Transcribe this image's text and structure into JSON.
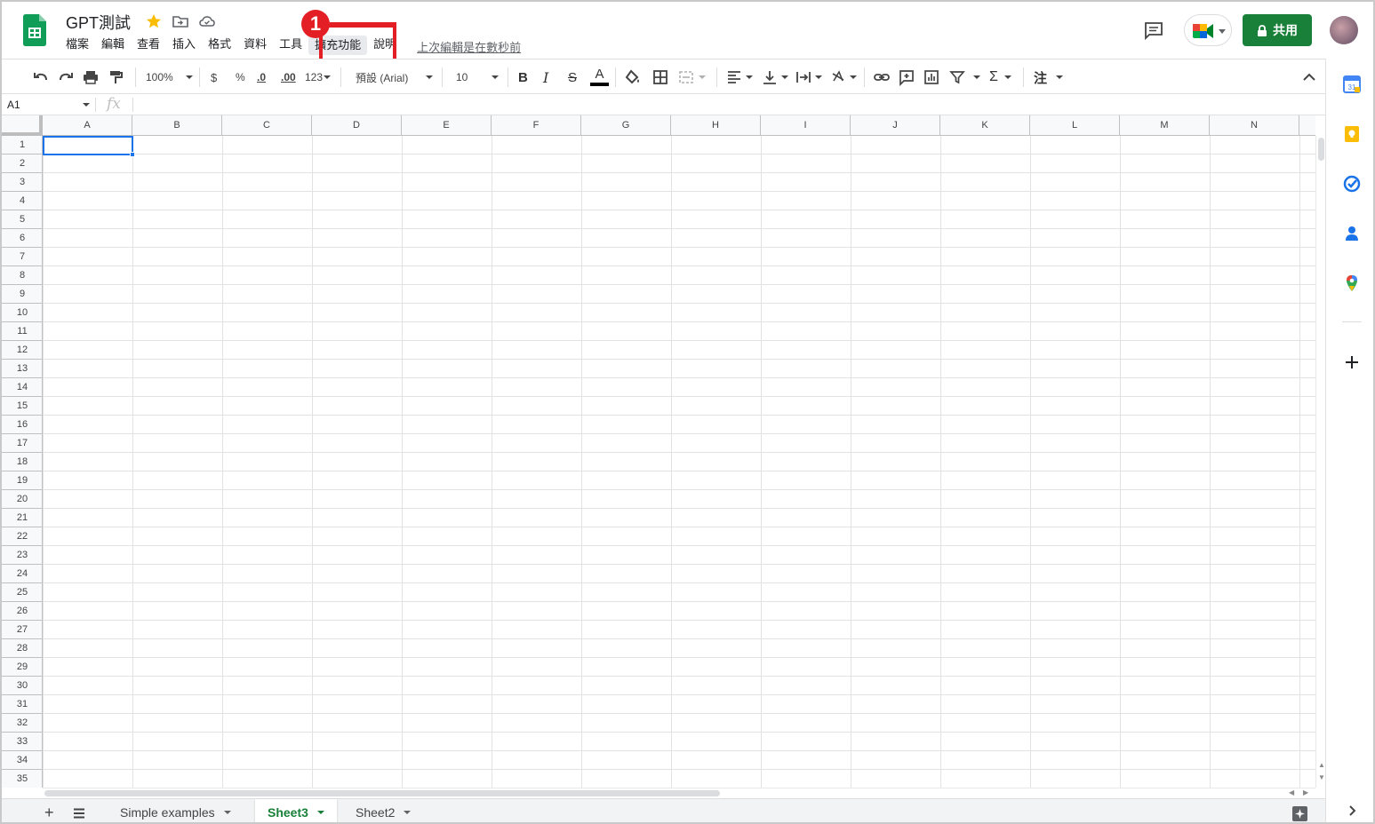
{
  "app": {
    "doc_title": "GPT測試",
    "last_edit": "上次編輯是在數秒前"
  },
  "menu": {
    "items": [
      "檔案",
      "編輯",
      "查看",
      "插入",
      "格式",
      "資料",
      "工具",
      "擴充功能",
      "說明"
    ],
    "active_index": 7
  },
  "annotation": {
    "step": "1",
    "color": "#e31e24"
  },
  "header": {
    "share_label": "共用",
    "share_color": "#188038"
  },
  "toolbar": {
    "zoom": "100%",
    "currency": "$",
    "percent": "%",
    "decrease_decimal": ".0",
    "increase_decimal": ".00",
    "more_formats": "123",
    "font": "預設 (Arial)",
    "font_size": "10",
    "bold": "B",
    "italic": "I",
    "strike": "S",
    "text_color": "A",
    "sigma": "Σ",
    "input_tools": "注"
  },
  "formula_bar": {
    "name_box": "A1",
    "fx": "fx"
  },
  "grid": {
    "columns": [
      "A",
      "B",
      "C",
      "D",
      "E",
      "F",
      "G",
      "H",
      "I",
      "J",
      "K",
      "L",
      "M",
      "N"
    ],
    "rows": [
      "1",
      "2",
      "3",
      "4",
      "5",
      "6",
      "7",
      "8",
      "9",
      "10",
      "11",
      "12",
      "13",
      "14",
      "15",
      "16",
      "17",
      "18",
      "19",
      "20",
      "21",
      "22",
      "23",
      "24",
      "25",
      "26",
      "27",
      "28",
      "29",
      "30",
      "31",
      "32",
      "33",
      "34",
      "35"
    ],
    "selected_cell": "A1"
  },
  "sheets": {
    "tabs": [
      "Simple examples",
      "Sheet3",
      "Sheet2"
    ],
    "active_index": 1
  },
  "side_panel": {
    "icons": [
      "calendar-icon",
      "keep-icon",
      "tasks-icon",
      "contacts-icon",
      "maps-icon",
      "add-icon"
    ]
  }
}
